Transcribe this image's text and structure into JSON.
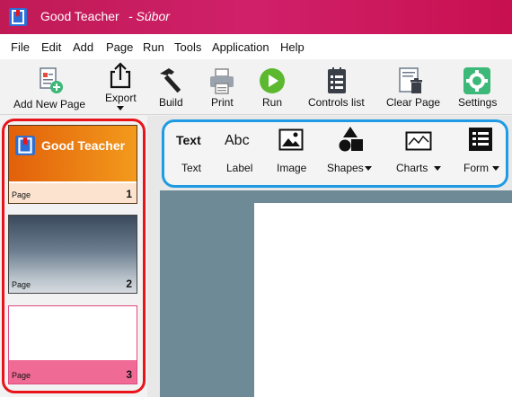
{
  "window": {
    "app_name": "Good Teacher",
    "document": "- Súbor"
  },
  "menu": [
    "File",
    "Edit",
    "Add",
    "Page",
    "Run",
    "Tools",
    "Application",
    "Help"
  ],
  "ribbon": {
    "add_new_page": "Add New Page",
    "export": "Export",
    "build": "Build",
    "print": "Print",
    "run": "Run",
    "controls_list": "Controls list",
    "clear_page": "Clear Page",
    "settings": "Settings"
  },
  "toolbox": {
    "text_icon": "Text",
    "text": "Text",
    "label_icon": "Abc",
    "label": "Label",
    "image": "Image",
    "shapes": "Shapes",
    "charts": "Charts",
    "form": "Form"
  },
  "pages": [
    {
      "label": "Page",
      "number": "1",
      "banner": "Good Teacher"
    },
    {
      "label": "Page",
      "number": "2"
    },
    {
      "label": "Page",
      "number": "3"
    }
  ],
  "colors": {
    "title_bar": "#c01a55",
    "page1_header": "#f07a10",
    "page3_footer": "#f06a96",
    "highlight_red": "#e8141a",
    "highlight_blue": "#1e9be4",
    "run_green": "#5cb82e",
    "settings_green": "#3cb878"
  }
}
